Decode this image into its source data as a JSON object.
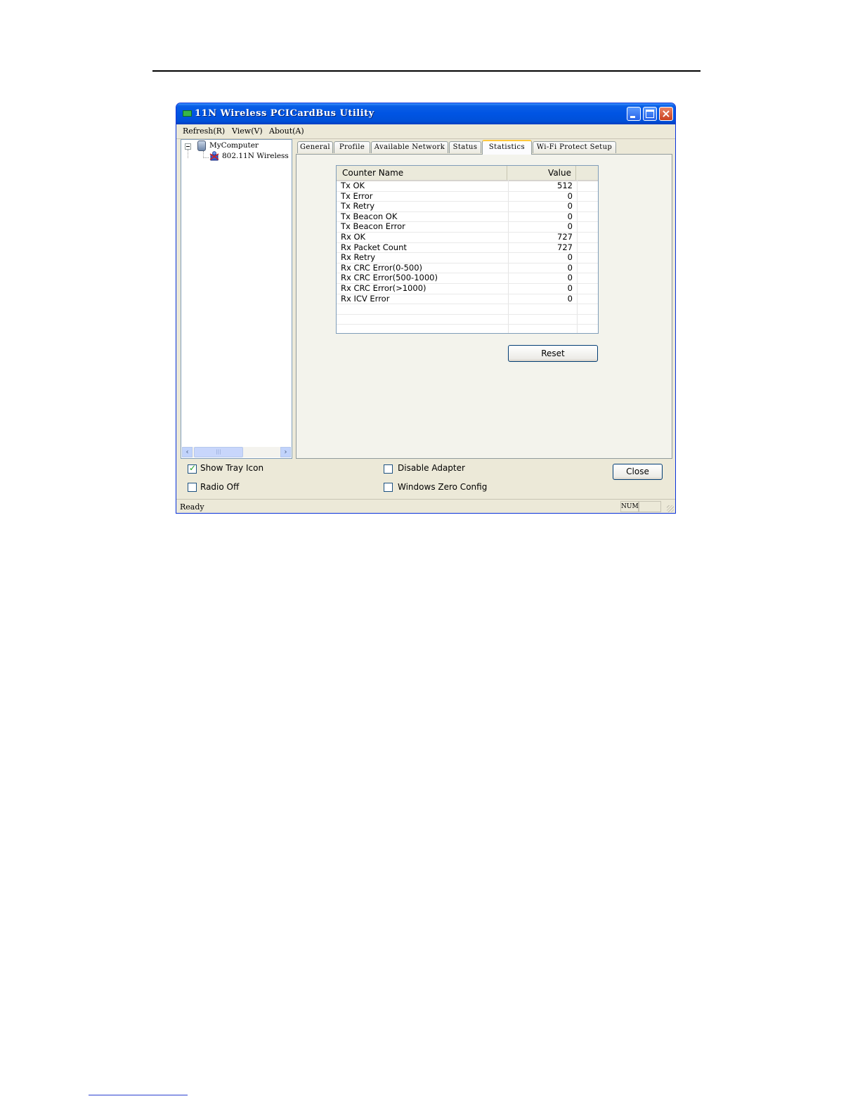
{
  "window": {
    "title": "11N Wireless PCICardBus Utility"
  },
  "menu": [
    "Refresh(R)",
    "View(V)",
    "About(A)"
  ],
  "tree": {
    "root": "MyComputer",
    "child": "802.11N Wireless"
  },
  "tabs": [
    "General",
    "Profile",
    "Available Network",
    "Status",
    "Statistics",
    "Wi-Fi Protect Setup"
  ],
  "active_tab": "Statistics",
  "statistics": {
    "headers": {
      "name": "Counter Name",
      "value": "Value"
    },
    "rows": [
      {
        "name": "Tx OK",
        "value": "512"
      },
      {
        "name": "Tx Error",
        "value": "0"
      },
      {
        "name": "Tx Retry",
        "value": "0"
      },
      {
        "name": "Tx Beacon OK",
        "value": "0"
      },
      {
        "name": "Tx Beacon Error",
        "value": "0"
      },
      {
        "name": "Rx OK",
        "value": "727"
      },
      {
        "name": "Rx Packet Count",
        "value": "727"
      },
      {
        "name": "Rx Retry",
        "value": "0"
      },
      {
        "name": "Rx CRC Error(0-500)",
        "value": "0"
      },
      {
        "name": "Rx CRC Error(500-1000)",
        "value": "0"
      },
      {
        "name": "Rx CRC Error(>1000)",
        "value": "0"
      },
      {
        "name": "Rx ICV Error",
        "value": "0"
      }
    ],
    "reset_label": "Reset"
  },
  "options": {
    "show_tray_icon": {
      "label": "Show Tray Icon",
      "checked": true
    },
    "radio_off": {
      "label": "Radio Off",
      "checked": false
    },
    "disable_adapter": {
      "label": "Disable Adapter",
      "checked": false
    },
    "windows_zero_config": {
      "label": "Windows Zero Config",
      "checked": false
    }
  },
  "close_label": "Close",
  "status": {
    "text": "Ready",
    "num": "NUM"
  },
  "colors": {
    "titlebar": "#0054e3",
    "active_tab_accent": "#ffc83c",
    "window_bg": "#ece9d8"
  }
}
